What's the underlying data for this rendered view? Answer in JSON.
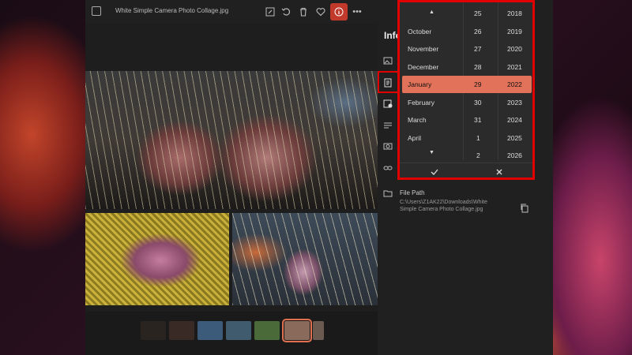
{
  "window": {
    "filename": "White Simple Camera Photo Collage.jpg"
  },
  "toolbar": {
    "icons": [
      "edit-icon",
      "rotate-icon",
      "delete-icon",
      "favorite-icon",
      "info-icon",
      "more-icon"
    ],
    "more_label": "•••"
  },
  "info_panel": {
    "heading": "Info",
    "file_path_label": "File Path",
    "file_path_value": "C:\\Users\\Z1AK22\\Downloads\\White Simple Camera Photo Collage.jpg"
  },
  "date_picker": {
    "months": [
      "October",
      "November",
      "December",
      "January",
      "February",
      "March",
      "April"
    ],
    "days": [
      "25",
      "26",
      "27",
      "28",
      "29",
      "30",
      "31",
      "1",
      "2"
    ],
    "years": [
      "2018",
      "2019",
      "2020",
      "2021",
      "2022",
      "2023",
      "2024",
      "2025",
      "2026"
    ],
    "selected": {
      "month": "January",
      "day": "29",
      "year": "2022"
    },
    "accept_icon": "check-icon",
    "cancel_icon": "close-icon",
    "accent": "#e2725a"
  },
  "colors": {
    "highlight_box": "#e00000",
    "accent": "#e2725a"
  }
}
